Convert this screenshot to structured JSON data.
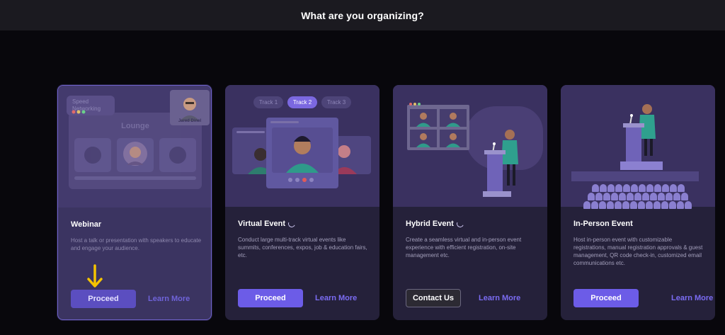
{
  "header": {
    "title": "What are you organizing?"
  },
  "cards": [
    {
      "title": "Webinar",
      "description": "Host a talk or presentation with speakers to educate and engage your audience.",
      "primary_label": "Proceed",
      "learn_label": "Learn More",
      "art": {
        "chip_line1": "Speed",
        "chip_line2": "Networking",
        "lounge": "Lounge",
        "host_name": "Jared Dinel"
      }
    },
    {
      "title": "Virtual Event",
      "description": "Conduct large multi-track virtual events like summits, conferences, expos, job & education fairs, etc.",
      "primary_label": "Proceed",
      "learn_label": "Learn More",
      "art": {
        "tracks": [
          "Track 1",
          "Track 2",
          "Track 3"
        ]
      }
    },
    {
      "title": "Hybrid Event",
      "description": "Create a seamless virtual and in-person event experience with efficient registration, on-site management etc.",
      "primary_label": "Contact Us",
      "learn_label": "Learn More"
    },
    {
      "title": "In-Person Event",
      "description": "Host in-person event with customizable registrations, manual registration approvals & guest management, QR code check-in, customized email communications etc.",
      "primary_label": "Proceed",
      "learn_label": "Learn More"
    }
  ],
  "colors": {
    "accent": "#6c5ce7",
    "link": "#7b6cf3",
    "arrow": "#f5c400",
    "card_bg": "#25213a",
    "page_bg": "#08070c"
  },
  "icons": [
    "arrow-down-icon",
    "loading-spinner-icon"
  ]
}
